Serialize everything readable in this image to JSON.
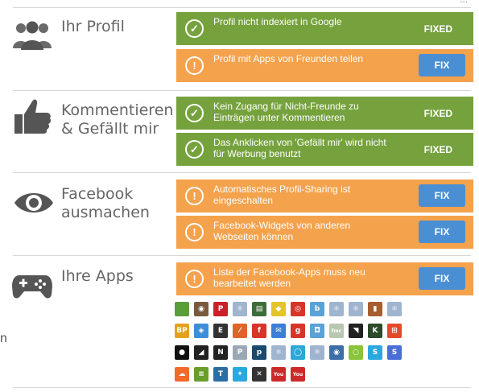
{
  "top_link": "...",
  "edge_fragment": "n",
  "categories": [
    {
      "label": "Ihr Profil",
      "icon": "users-icon",
      "items": [
        {
          "text": "Profil nicht indexiert in Google",
          "state": "fixed",
          "status": "FIXED"
        },
        {
          "text": "Profil mit Apps von Freunden teilen",
          "state": "fix",
          "status": "FIX"
        }
      ]
    },
    {
      "label": "Kommentieren & Gefällt mir",
      "icon": "thumbs-up-icon",
      "items": [
        {
          "text": "Kein Zugang für Nicht-Freunde zu Einträgen unter Kommentieren",
          "state": "fixed",
          "status": "FIXED"
        },
        {
          "text": "Das Anklicken von 'Gefällt mir' wird nicht für Werbung benutzt",
          "state": "fixed",
          "status": "FIXED"
        }
      ]
    },
    {
      "label": "Facebook ausmachen",
      "icon": "eye-icon",
      "items": [
        {
          "text": "Automatisches Profil-Sharing ist eingeschalten",
          "state": "fix",
          "status": "FIX"
        },
        {
          "text": "Facebook-Widgets von anderen Webseiten können",
          "state": "fix",
          "status": "FIX"
        }
      ]
    },
    {
      "label": "Ihre Apps",
      "icon": "gamepad-icon",
      "items": [
        {
          "text": "Liste der Facebook-Apps muss neu bearbeitet werden",
          "state": "fix",
          "status": "FIX"
        }
      ]
    }
  ],
  "icon_text": {
    "check": "✓",
    "warning": "!"
  },
  "colors": {
    "fixed": "#76a23e",
    "fix": "#f4a24c",
    "button": "#4a8fd4",
    "category_icon": "#555555"
  },
  "app_icons": [
    [
      {
        "name": "leaf-app-icon",
        "text": "",
        "color": "#5a9e3c"
      },
      {
        "name": "camera-app-icon",
        "text": "◉",
        "color": "#7a5a3e"
      },
      {
        "name": "pinterest-app-icon",
        "text": "P",
        "color": "#cb2027"
      },
      {
        "name": "atom-app-icon",
        "text": "⚛",
        "color": "#9fb4cf"
      },
      {
        "name": "green-app-icon",
        "text": "▤",
        "color": "#3c6e3a"
      },
      {
        "name": "yellow-app-icon",
        "text": "◆",
        "color": "#e4c42a"
      },
      {
        "name": "target-app-icon",
        "text": "◎",
        "color": "#d8352a"
      },
      {
        "name": "b-app-icon",
        "text": "b",
        "color": "#5aa2d8"
      },
      {
        "name": "atom-app-icon-2",
        "text": "⚛",
        "color": "#9fb4cf"
      },
      {
        "name": "atom-app-icon-3",
        "text": "⚛",
        "color": "#9fb4cf"
      },
      {
        "name": "bottles-app-icon",
        "text": "▮",
        "color": "#a65e2e"
      },
      {
        "name": "atom-app-icon-4",
        "text": "⚛",
        "color": "#9fb4cf"
      }
    ],
    [
      {
        "name": "bp-app-icon",
        "text": "BP",
        "color": "#e4a21c"
      },
      {
        "name": "dropbox-app-icon",
        "text": "◈",
        "color": "#3d8ed8"
      },
      {
        "name": "e-app-icon",
        "text": "E",
        "color": "#333333"
      },
      {
        "name": "slash-app-icon",
        "text": "⁄",
        "color": "#e0642a"
      },
      {
        "name": "flipboard-app-icon",
        "text": "f",
        "color": "#d8352a"
      },
      {
        "name": "mail-app-icon",
        "text": "✉",
        "color": "#3d7ed8"
      },
      {
        "name": "g-app-icon",
        "text": "g",
        "color": "#d8352a"
      },
      {
        "name": "blue-app-icon",
        "text": "◘",
        "color": "#5aa2d8"
      },
      {
        "name": "fmc-app-icon",
        "text": "fmc",
        "color": "#b8c8b0"
      },
      {
        "name": "flag-app-icon",
        "text": "◥",
        "color": "#222222"
      },
      {
        "name": "k-app-icon",
        "text": "K",
        "color": "#2c4a2c"
      },
      {
        "name": "windows-app-icon",
        "text": "⊞",
        "color": "#e44a2a"
      }
    ],
    [
      {
        "name": "drop-app-icon",
        "text": "●",
        "color": "#111111"
      },
      {
        "name": "batman-app-icon",
        "text": "◢",
        "color": "#222222"
      },
      {
        "name": "n-app-icon",
        "text": "N",
        "color": "#222222"
      },
      {
        "name": "p-app-icon",
        "text": "P",
        "color": "#9aa8b6"
      },
      {
        "name": "p-dark-app-icon",
        "text": "p",
        "color": "#1c4a6e"
      },
      {
        "name": "atom-app-icon-5",
        "text": "⚛",
        "color": "#9fb4cf"
      },
      {
        "name": "ring-app-icon",
        "text": "◯",
        "color": "#2aa8d8"
      },
      {
        "name": "atom-app-icon-6",
        "text": "⚛",
        "color": "#9fb4cf"
      },
      {
        "name": "swirl-app-icon",
        "text": "◉",
        "color": "#3d6ea8"
      },
      {
        "name": "circle-app-icon",
        "text": "○",
        "color": "#8ac43a"
      },
      {
        "name": "skype-app-icon",
        "text": "S",
        "color": "#2aa8e0"
      },
      {
        "name": "s-app-icon",
        "text": "S",
        "color": "#4a6ed8"
      }
    ],
    [
      {
        "name": "soundcloud-app-icon",
        "text": "☁",
        "color": "#f06a2a"
      },
      {
        "name": "spotify-app-icon",
        "text": "≡",
        "color": "#6a9e2a"
      },
      {
        "name": "t-app-icon",
        "text": "T",
        "color": "#2a6ea8"
      },
      {
        "name": "twitter-app-icon",
        "text": "✦",
        "color": "#2aa8e0"
      },
      {
        "name": "x-app-icon",
        "text": "✕",
        "color": "#333333"
      },
      {
        "name": "youtube-app-icon",
        "text": "You",
        "color": "#cc2a2a"
      },
      {
        "name": "youtube-app-icon-2",
        "text": "You",
        "color": "#cc2a2a"
      }
    ]
  ]
}
